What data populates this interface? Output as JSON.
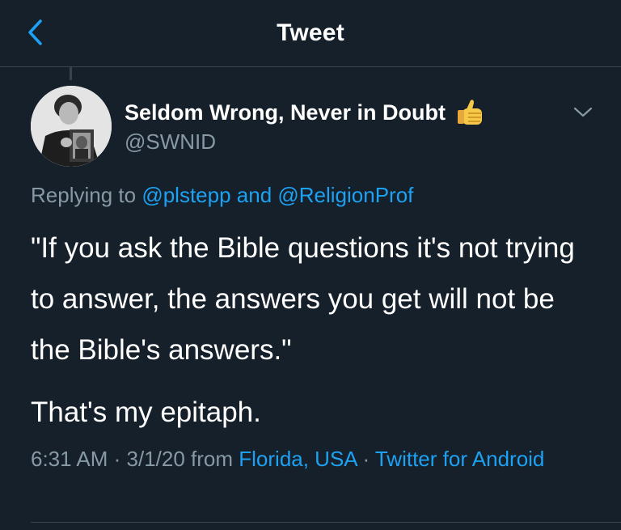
{
  "header": {
    "title": "Tweet",
    "back_icon": "chevron-left-icon"
  },
  "tweet": {
    "author": {
      "display_name": "Seldom Wrong, Never in Doubt",
      "emoji": "👍",
      "handle": "@SWNID"
    },
    "replying": {
      "prefix": "Replying to ",
      "user1": "@plstepp",
      "conjunction": " and ",
      "user2": "@ReligionProf"
    },
    "body": {
      "paragraph1": "\"If you ask the Bible questions it's not trying to answer, the answers you get will not be the Bible's answers.\"",
      "paragraph2": "That's my epitaph."
    },
    "meta": {
      "time": "6:31 AM",
      "separator": " · ",
      "date": "3/1/20",
      "from_label": " from ",
      "location": "Florida, USA",
      "separator2": " · ",
      "source": "Twitter for Android"
    }
  },
  "colors": {
    "background": "#15202b",
    "accent": "#1da1f2",
    "secondary_text": "#8899a6",
    "divider": "#38444d"
  }
}
